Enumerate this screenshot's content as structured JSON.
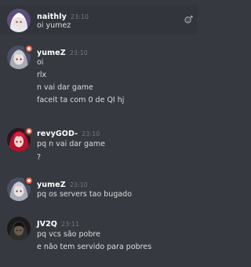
{
  "messages": [
    {
      "username": "naithly",
      "time": "23:10",
      "lines": [
        "oi yumez"
      ],
      "avatar": "white-haired-anime-girl",
      "highlighted": true
    },
    {
      "username": "yumeZ",
      "time": "23:10",
      "lines": [
        "oi",
        "rlx",
        "n vai dar game",
        "faceit ta com 0 de QI hj"
      ],
      "avatar": "grey-haired-anime-character",
      "badge": "orange-status-badge"
    },
    {
      "username": "revyGOD-",
      "time": "23:10",
      "lines": [
        "pq n vai dar game",
        "?"
      ],
      "avatar": "red-anime-character",
      "badge": "orange-status-badge"
    },
    {
      "username": "yumeZ",
      "time": "23:10",
      "lines": [
        "pq os servers tao bugado"
      ],
      "avatar": "grey-haired-anime-character",
      "badge": "orange-status-badge"
    },
    {
      "username": "JV2Q",
      "time": "23:11",
      "lines": [
        "pq vcs são pobre",
        "e não tem servido para pobres"
      ],
      "avatar": "dark-hooded-character"
    }
  ],
  "colors": {
    "background": "#36393f",
    "username": "#ffffff",
    "message_text": "#dcddde",
    "timestamp": "#72767d",
    "badge": "#e55d3d"
  }
}
